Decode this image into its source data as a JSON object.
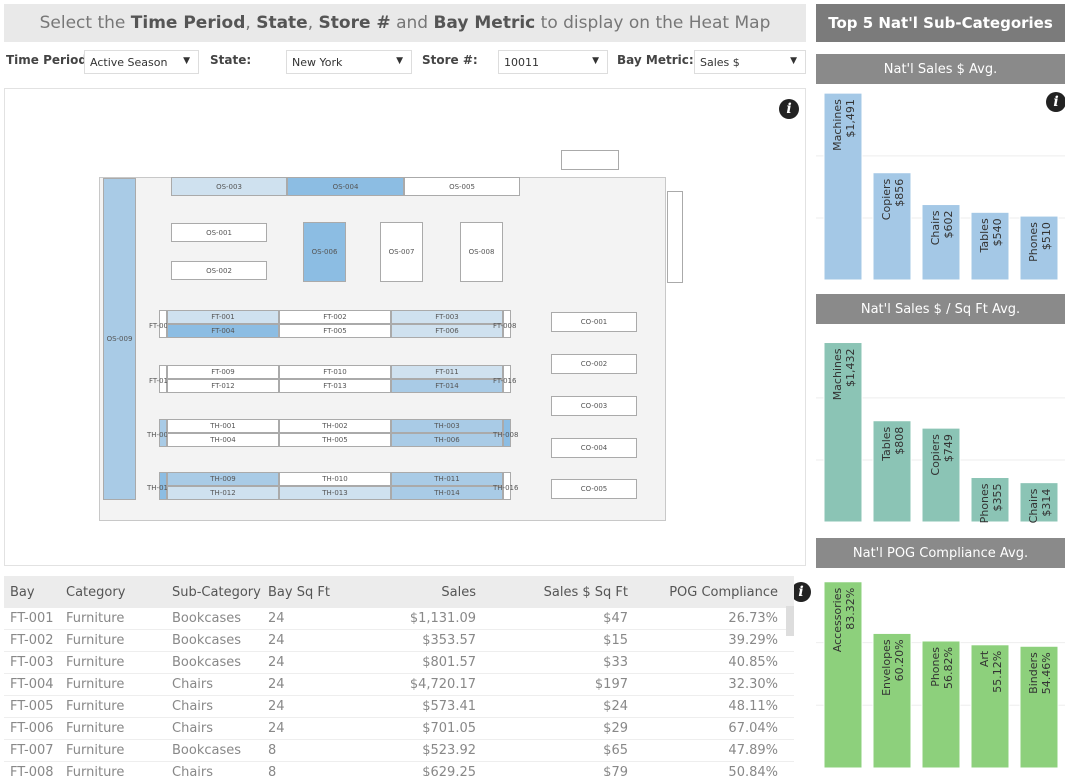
{
  "banner": {
    "p1": "Select the ",
    "b1": "Time Period",
    "p2": ", ",
    "b2": "State",
    "p3": ", ",
    "b3": "Store #",
    "p4": " and ",
    "b4": "Bay Metric",
    "p5": " to display on the Heat Map"
  },
  "filters": {
    "time_label": "Time Period",
    "time_value": "Active Season",
    "state_label": "State:",
    "state_value": "New York",
    "store_label": "Store #:",
    "store_value": "10011",
    "metric_label": "Bay Metric:",
    "metric_value": "Sales $"
  },
  "icons": {
    "info": "info-icon",
    "dropdown": "chevron-down-icon"
  },
  "info_glyph": "i",
  "bays": {
    "os003": "OS-003",
    "os004": "OS-004",
    "os005": "OS-005",
    "os001": "OS-001",
    "os002": "OS-002",
    "os006": "OS-006",
    "os007": "OS-007",
    "os008": "OS-008",
    "os009": "OS-009",
    "ft001": "FT-001",
    "ft002": "FT-002",
    "ft003": "FT-003",
    "ft004": "FT-004",
    "ft005": "FT-005",
    "ft006": "FT-006",
    "ft007": "FT-007",
    "ft008": "FT-008",
    "ft009": "FT-009",
    "ft010": "FT-010",
    "ft011": "FT-011",
    "ft012": "FT-012",
    "ft013": "FT-013",
    "ft014": "FT-014",
    "ft015": "FT-015",
    "ft016": "FT-016",
    "th001": "TH-001",
    "th002": "TH-002",
    "th003": "TH-003",
    "th004": "TH-004",
    "th005": "TH-005",
    "th006": "TH-006",
    "th007": "TH-007",
    "th008": "TH-008",
    "th009": "TH-009",
    "th010": "TH-010",
    "th011": "TH-011",
    "th012": "TH-012",
    "th013": "TH-013",
    "th014": "TH-014",
    "th015": "TH-015",
    "th016": "TH-016",
    "co001": "CO-001",
    "co002": "CO-002",
    "co003": "CO-003",
    "co004": "CO-004",
    "co005": "CO-005"
  },
  "right_panel": {
    "title": "Top 5 Nat'l Sub-Categories",
    "sub1": "Nat'l Sales $ Avg.",
    "sub2": "Nat'l Sales $ / Sq Ft Avg.",
    "sub3": "Nat'l POG Compliance Avg."
  },
  "chart_data": [
    {
      "type": "bar",
      "title": "Nat'l Sales $ Avg.",
      "categories": [
        "Machines",
        "Copiers",
        "Chairs",
        "Tables",
        "Phones"
      ],
      "values": [
        1491,
        856,
        602,
        540,
        510
      ],
      "labels": [
        "$1,491",
        "$856",
        "$602",
        "$540",
        "$510"
      ],
      "color": "#a4c8e6",
      "ylim": [
        0,
        1500
      ]
    },
    {
      "type": "bar",
      "title": "Nat'l Sales $ / Sq Ft Avg.",
      "categories": [
        "Machines",
        "Tables",
        "Copiers",
        "Phones",
        "Chairs"
      ],
      "values": [
        1432,
        808,
        749,
        355,
        314
      ],
      "labels": [
        "$1,432",
        "$808",
        "$749",
        "$355",
        "$314"
      ],
      "color": "#8bc4b5",
      "ylim": [
        0,
        1500
      ]
    },
    {
      "type": "bar",
      "title": "Nat'l POG Compliance Avg.",
      "categories": [
        "Accessories",
        "Envelopes",
        "Phones",
        "Art",
        "Binders"
      ],
      "values": [
        83.32,
        60.2,
        56.82,
        55.12,
        54.46
      ],
      "labels": [
        "83.32%",
        "60.20%",
        "56.82%",
        "55.12%",
        "54.46%"
      ],
      "color": "#8dd07c",
      "ylim": [
        0,
        85
      ]
    }
  ],
  "table": {
    "headers": [
      "Bay",
      "Category",
      "Sub-Category",
      "Bay Sq Ft",
      "Sales",
      "Sales $ Sq Ft",
      "POG Compliance"
    ],
    "rows": [
      [
        "FT-001",
        "Furniture",
        "Bookcases",
        "24",
        "$1,131.09",
        "$47",
        "26.73%"
      ],
      [
        "FT-002",
        "Furniture",
        "Bookcases",
        "24",
        "$353.57",
        "$15",
        "39.29%"
      ],
      [
        "FT-003",
        "Furniture",
        "Bookcases",
        "24",
        "$801.57",
        "$33",
        "40.85%"
      ],
      [
        "FT-004",
        "Furniture",
        "Chairs",
        "24",
        "$4,720.17",
        "$197",
        "32.30%"
      ],
      [
        "FT-005",
        "Furniture",
        "Chairs",
        "24",
        "$573.41",
        "$24",
        "48.11%"
      ],
      [
        "FT-006",
        "Furniture",
        "Chairs",
        "24",
        "$701.05",
        "$29",
        "67.04%"
      ],
      [
        "FT-007",
        "Furniture",
        "Bookcases",
        "8",
        "$523.92",
        "$65",
        "47.89%"
      ],
      [
        "FT-008",
        "Furniture",
        "Chairs",
        "8",
        "$629.25",
        "$79",
        "50.84%"
      ]
    ]
  }
}
